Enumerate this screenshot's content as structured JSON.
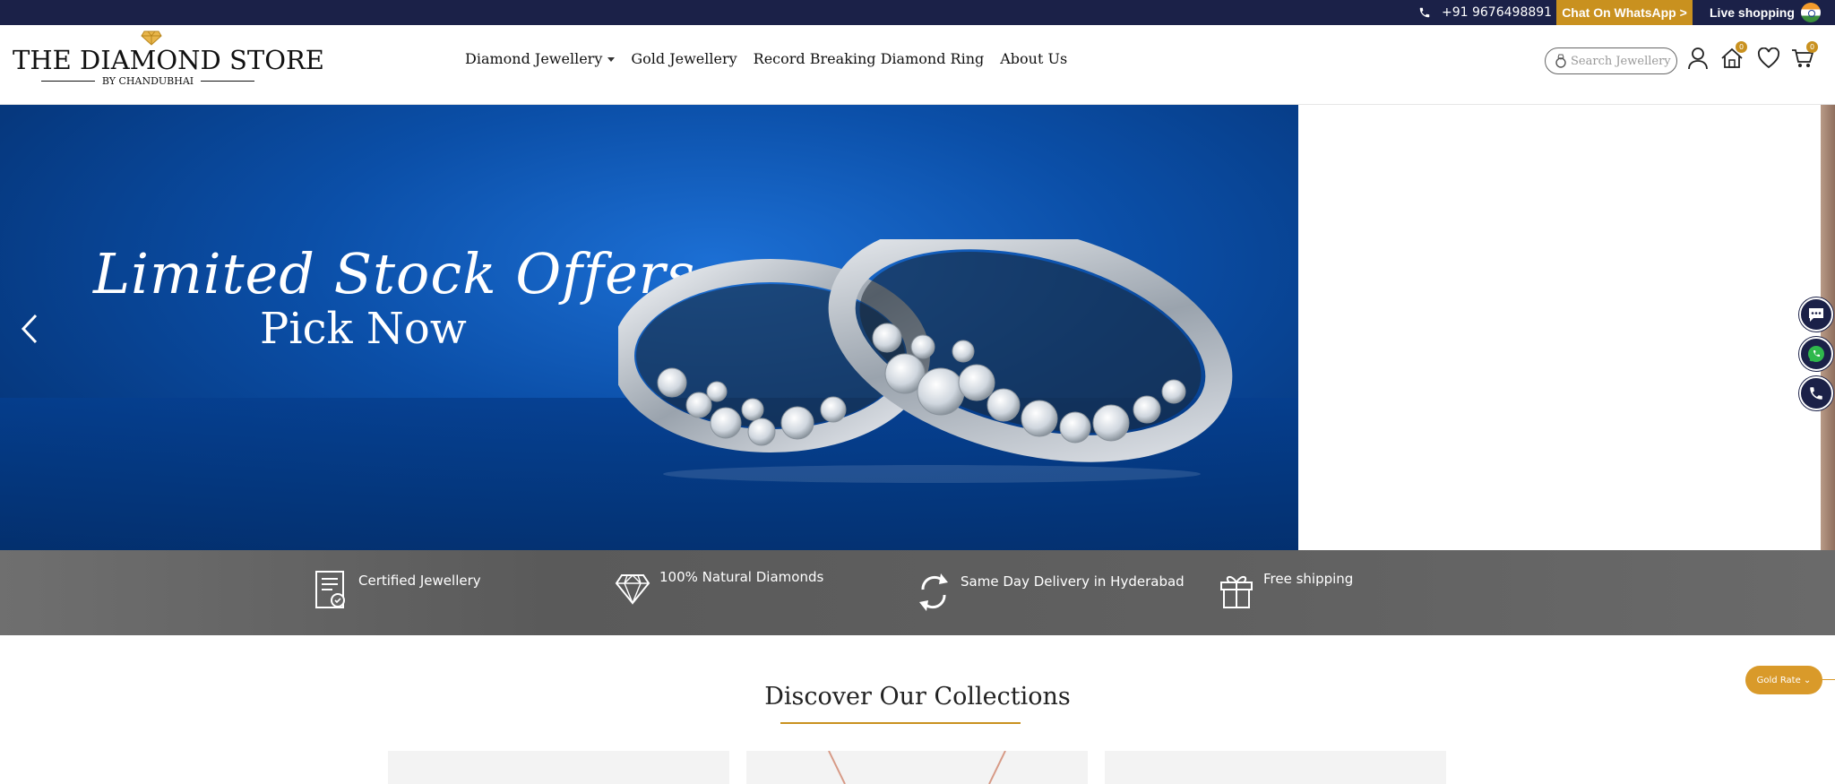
{
  "topbar": {
    "phone": "+91 9676498891",
    "whatsapp_label": "Chat On WhatsApp >",
    "live_label": "Live shopping"
  },
  "header": {
    "logo_title": "THE DIAMOND STORE",
    "logo_sub": "BY CHANDUBHAI",
    "nav": [
      "Diamond Jewellery",
      "Gold Jewellery",
      "Record Breaking Diamond Ring",
      "About Us"
    ],
    "search_placeholder": "Search Jewellery",
    "home_badge": "0",
    "cart_badge": "0"
  },
  "hero": {
    "script_text": "Limited Stock Offers",
    "cta_text": "Pick Now"
  },
  "features": [
    {
      "label": "Certified Jewellery",
      "icon": "certificate-icon"
    },
    {
      "label": "100% Natural Diamonds",
      "icon": "diamond-icon"
    },
    {
      "label": "Same Day Delivery in Hyderabad",
      "icon": "refresh-icon"
    },
    {
      "label": "Free shipping",
      "icon": "gift-icon"
    }
  ],
  "collections": {
    "title": "Discover Our Collections"
  },
  "floating": {
    "gold_rate_label": "Gold Rate ⌄"
  },
  "colors": {
    "navy": "#1b2148",
    "gold": "#c9911f",
    "hero_blue": "#0b4fa8"
  }
}
